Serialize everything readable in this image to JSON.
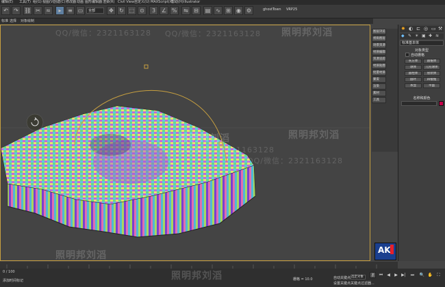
{
  "menu": {
    "items": [
      "编辑(E)",
      "工具(T)",
      "组(G)",
      "视图(V)",
      "创建(C)",
      "修改器",
      "动画",
      "图形编辑器",
      "渲染(R)",
      "Civil View",
      "自定义(U)",
      "MAXScript(X)",
      "帮助(H)",
      "Illustrator"
    ]
  },
  "toolbar": {
    "selection_filter": "全部",
    "plugin_labels": [
      "ghostTown",
      "VRP25"
    ]
  },
  "ribbon": {
    "items": [
      "标准",
      "选择",
      "对象绘制"
    ]
  },
  "side_tools": {
    "items": [
      "图层浏览",
      "视角图层",
      "场景资源",
      "材质编辑",
      "资源追踪",
      "材质贴图",
      "批量材质",
      "蒙皮",
      "渲染",
      "素材",
      "工具"
    ]
  },
  "command_panel": {
    "dropdown": "标准基本体",
    "section_title": "对象类型",
    "autogrid": "自动栅格",
    "buttons": [
      "长方体",
      "圆锥体",
      "球体",
      "几何球体",
      "圆柱体",
      "管状体",
      "圆环",
      "四棱锥",
      "茶壶",
      "平面"
    ],
    "name_color_title": "名称和颜色",
    "object_color": "#c8004a"
  },
  "status": {
    "grid": "栅格 = 10.0",
    "autokey": "自动关键点",
    "set_key": "设置关键点",
    "selected": "选定对象",
    "key_filters": "关键点过滤器...",
    "add_time_tag": "添加时间标记",
    "frame_counter": "0 / 100"
  },
  "watermarks": {
    "qq_line": "QQ/微信：2321163128",
    "name_line": "照明邦刘滔"
  },
  "logo_text": "AK",
  "colors": {
    "accent": "#c8a040",
    "panel": "#3f3f3f",
    "viewport_bg": "#444444"
  }
}
